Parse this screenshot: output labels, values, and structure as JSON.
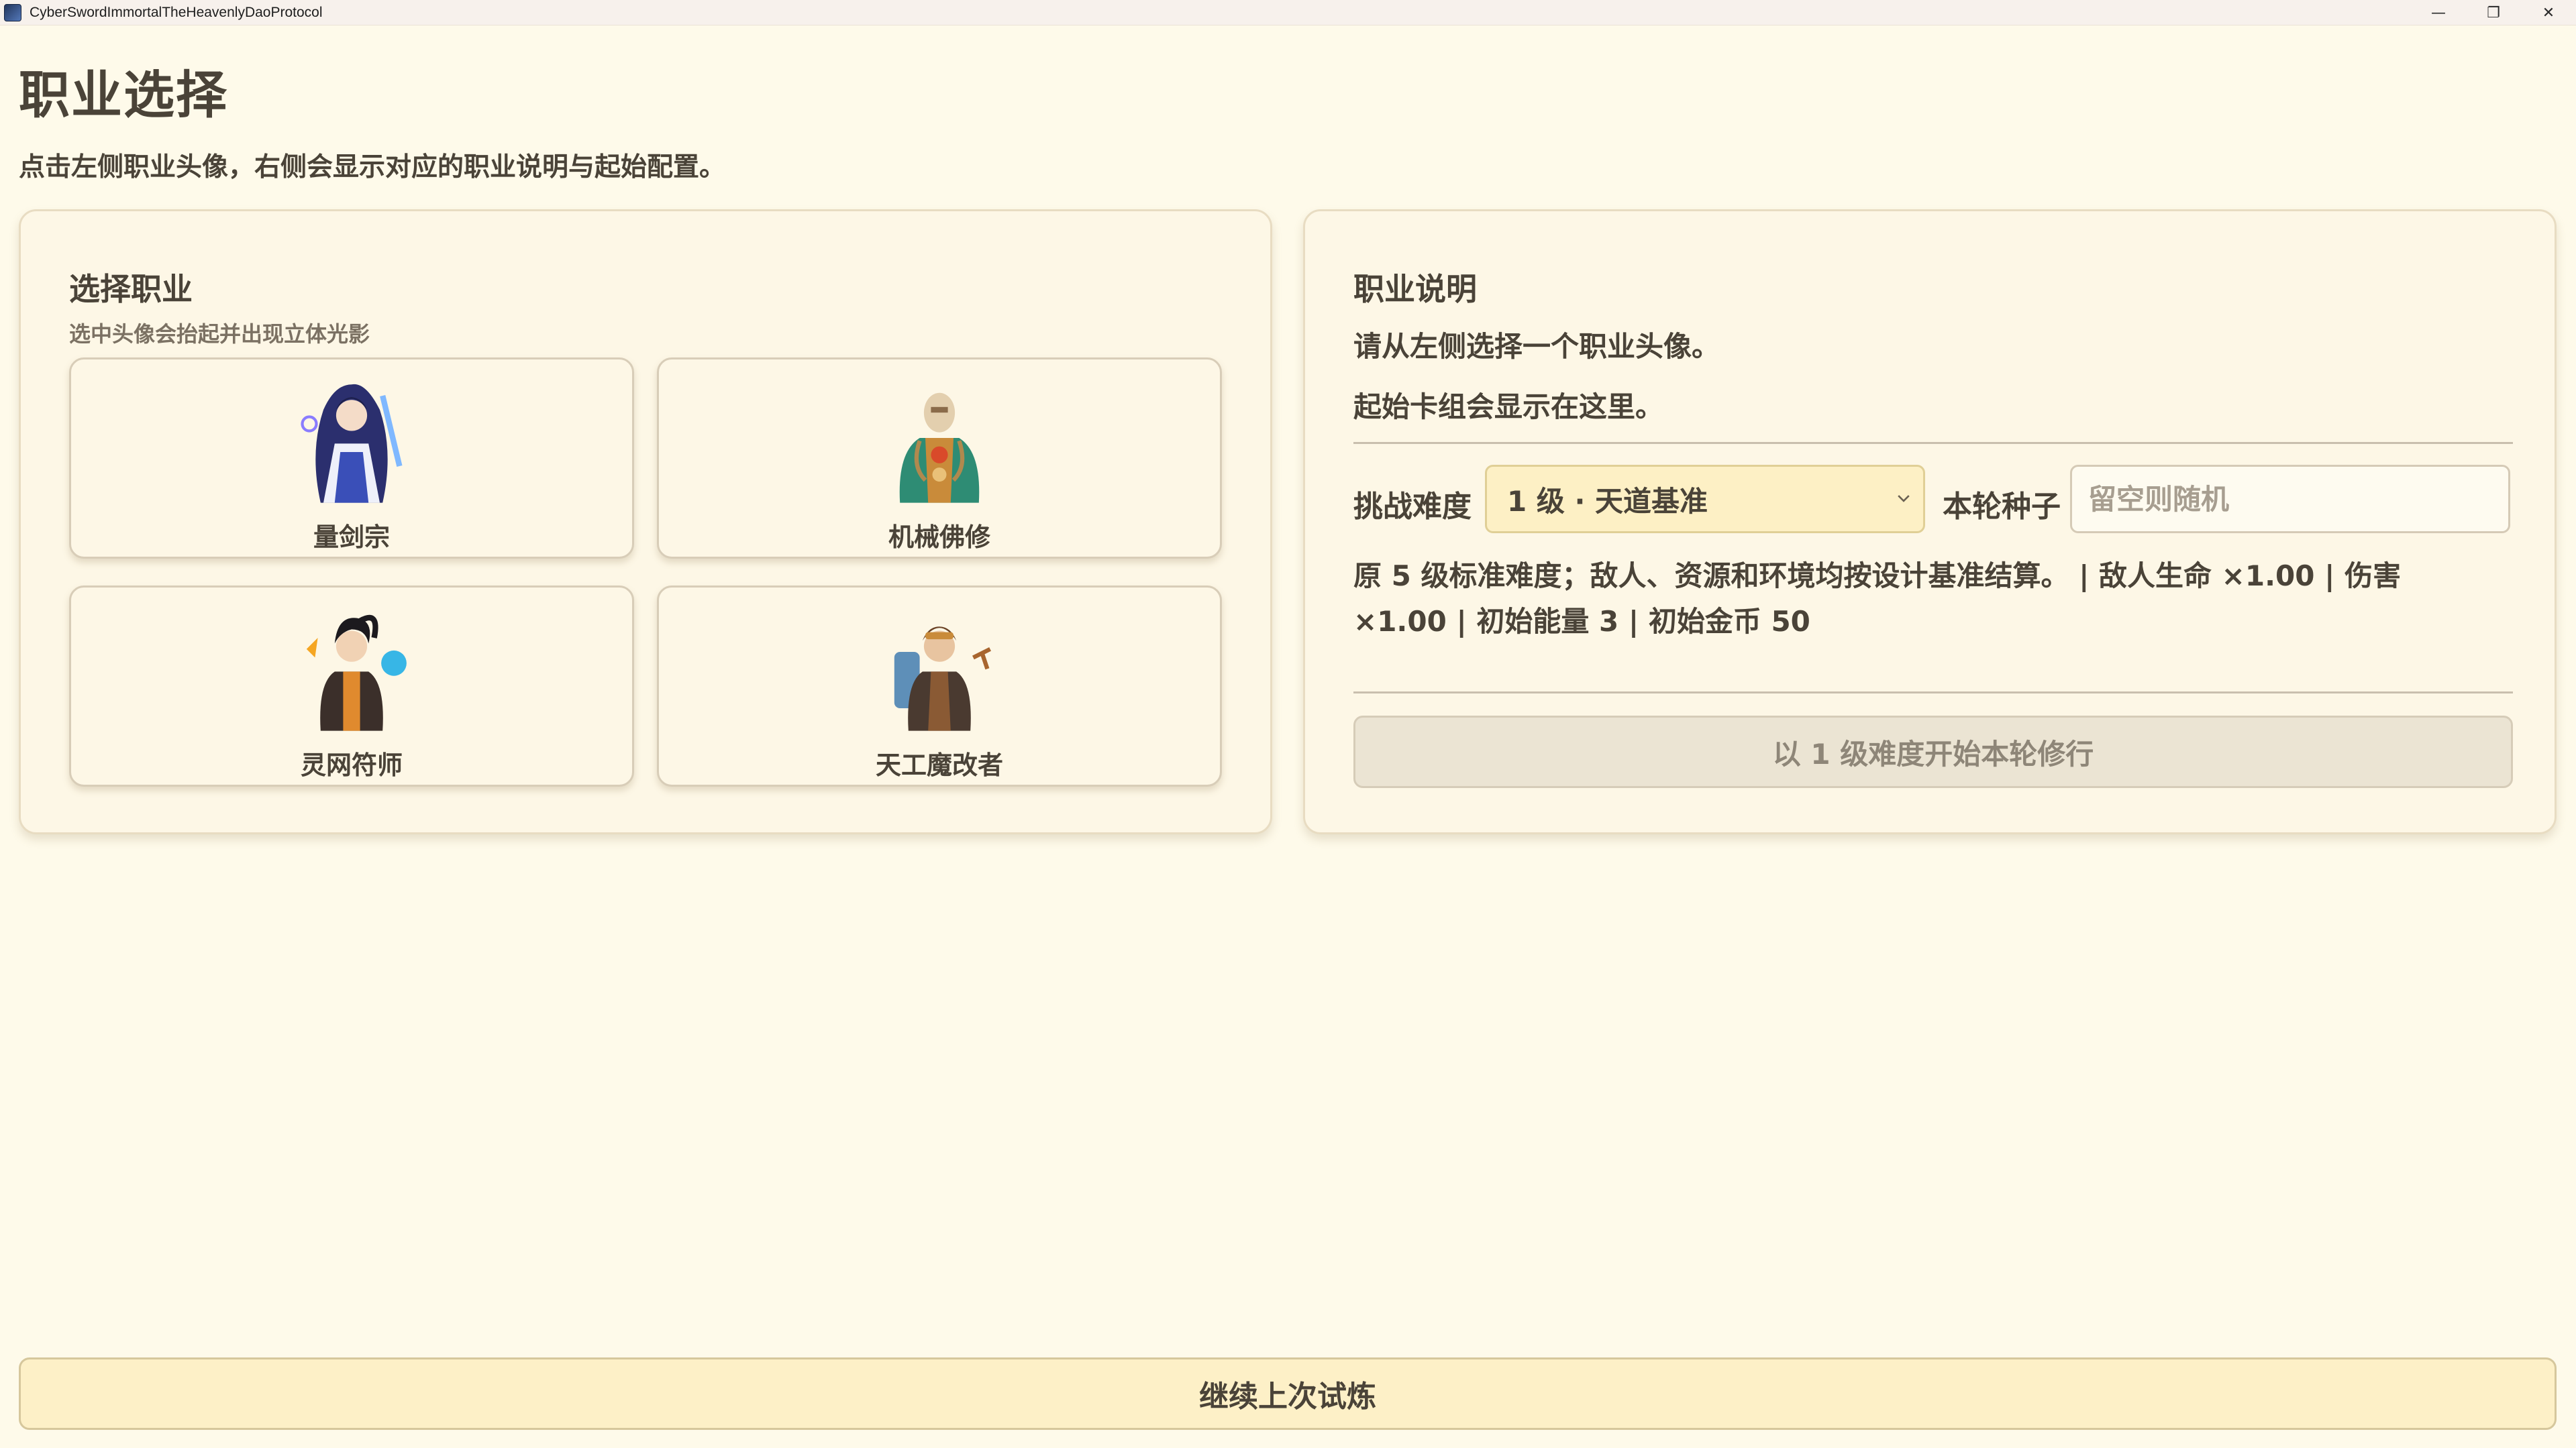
{
  "window": {
    "title": "CyberSwordImmortalTheHeavenlyDaoProtocol",
    "controls": {
      "minimize": "—",
      "restore": "❐",
      "close": "✕"
    }
  },
  "page": {
    "title": "职业选择",
    "subtitle": "点击左侧职业头像，右侧会显示对应的职业说明与起始配置。"
  },
  "class_panel": {
    "heading": "选择职业",
    "hint": "选中头像会抬起并出现立体光影",
    "classes": [
      {
        "name": "量剑宗",
        "icon": "sword-cultivator-avatar",
        "accent": "#2f3f9c"
      },
      {
        "name": "机械佛修",
        "icon": "mech-monk-avatar",
        "accent": "#2e8c74"
      },
      {
        "name": "灵网符师",
        "icon": "talisman-master-avatar",
        "accent": "#e08a2e"
      },
      {
        "name": "天工魔改者",
        "icon": "artificer-modder-avatar",
        "accent": "#8a5a34"
      }
    ]
  },
  "desc_panel": {
    "heading": "职业说明",
    "line1": "请从左侧选择一个职业头像。",
    "line2": "起始卡组会显示在这里。",
    "difficulty_label": "挑战难度",
    "difficulty_value": "1 级 · 天道基准",
    "seed_label": "本轮种子",
    "seed_placeholder": "留空则随机",
    "seed_value": "",
    "info": "原 5 级标准难度；敌人、资源和环境均按设计基准结算。 | 敌人生命 ×1.00 | 伤害 ×1.00 | 初始能量 3 | 初始金币 50",
    "start_button": "以 1 级难度开始本轮修行"
  },
  "continue_button": "继续上次试炼",
  "colors": {
    "background": "#fefaea",
    "panel": "#fdf7e6",
    "select_fill": "#fdf0c5",
    "disabled_button": "#ebe4d3",
    "continue_fill": "#fdf0c7"
  }
}
